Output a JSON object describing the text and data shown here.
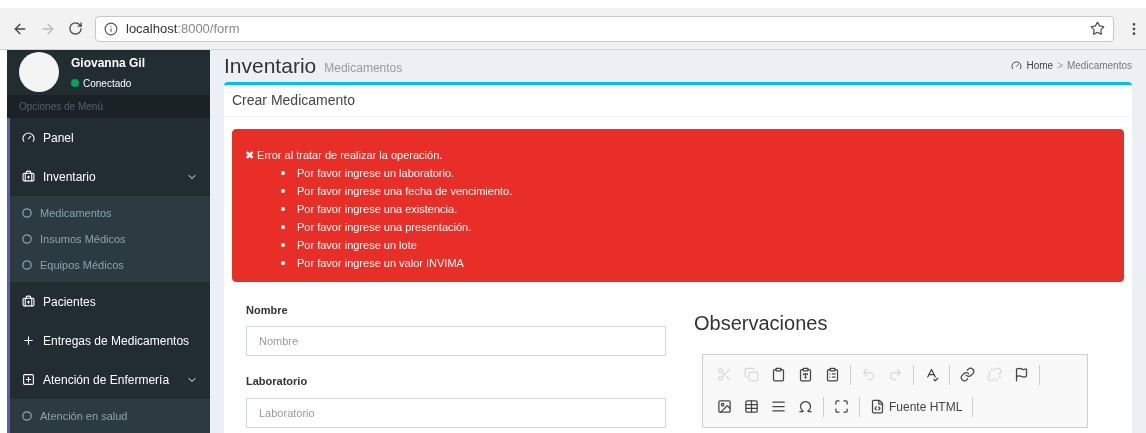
{
  "browser": {
    "url_host": "localhost",
    "url_path": ":8000/form"
  },
  "user": {
    "name": "Giovanna Gil",
    "status": "Conectado"
  },
  "sidebar": {
    "header": "Opciones de Menú",
    "items": [
      {
        "label": "Panel",
        "kind": "dashboard"
      },
      {
        "label": "Inventario",
        "kind": "medkit",
        "expanded": true,
        "children": [
          {
            "label": "Medicamentos"
          },
          {
            "label": "Insumos Médicos"
          },
          {
            "label": "Equipos Médicos"
          }
        ]
      },
      {
        "label": "Pacientes",
        "kind": "medkit"
      },
      {
        "label": "Entregas de Medicamentos",
        "kind": "plus"
      },
      {
        "label": "Atención de Enfermería",
        "kind": "plus-square",
        "expanded": true,
        "children": [
          {
            "label": "Atención en salud"
          }
        ]
      }
    ]
  },
  "page": {
    "title": "Inventario",
    "subtitle": "Medicamentos",
    "breadcrumb": [
      "Home",
      "Medicamentos"
    ],
    "breadcrumb_separator": ">"
  },
  "card": {
    "title": "Crear Medicamento",
    "alert": {
      "icon": "✖",
      "title": "Error al tratar de realizar la operación.",
      "items": [
        "Por favor ingrese un laboratorio.",
        "Por favor ingrese una fecha de vencimiento.",
        "Por favor ingrese una existencia.",
        "Por favor ingrese una presentación.",
        "Por favor ingrese un lote",
        "Por favor ingrese un valor INVIMA"
      ]
    },
    "fields": [
      {
        "label": "Nombre",
        "placeholder": "Nombre"
      },
      {
        "label": "Laboratorio",
        "placeholder": "Laboratorio"
      }
    ],
    "observations": {
      "title": "Observaciones",
      "toolbar": [
        [
          {
            "kind": "cut",
            "disabled": true
          },
          {
            "kind": "copy",
            "disabled": true
          },
          {
            "kind": "paste",
            "disabled": false
          },
          {
            "kind": "paste-text",
            "disabled": false
          },
          {
            "kind": "paste-word",
            "disabled": false
          },
          {
            "kind": "separator"
          },
          {
            "kind": "undo",
            "disabled": true
          },
          {
            "kind": "redo",
            "disabled": true
          },
          {
            "kind": "separator"
          },
          {
            "kind": "spellcheck",
            "disabled": false
          },
          {
            "kind": "separator"
          },
          {
            "kind": "link",
            "disabled": false
          },
          {
            "kind": "unlink",
            "disabled": true
          },
          {
            "kind": "anchor",
            "disabled": false
          },
          {
            "kind": "separator"
          }
        ],
        [
          {
            "kind": "image",
            "disabled": false
          },
          {
            "kind": "table",
            "disabled": false
          },
          {
            "kind": "rule",
            "disabled": false
          },
          {
            "kind": "special-char",
            "disabled": false
          },
          {
            "kind": "separator"
          },
          {
            "kind": "maximize",
            "disabled": false
          },
          {
            "kind": "separator"
          },
          {
            "kind": "source",
            "label": "Fuente HTML",
            "disabled": false
          },
          {
            "kind": "separator"
          }
        ]
      ]
    }
  }
}
